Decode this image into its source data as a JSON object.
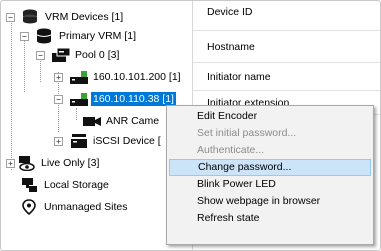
{
  "tree": {
    "vrm_devices": "VRM Devices [1]",
    "primary_vrm": "Primary VRM [1]",
    "pool": "Pool 0 [3]",
    "device_1": "160.10.101.200 [1]",
    "device_2": "160.10.110.38 [1]",
    "anr_camera": "ANR Came",
    "iscsi_device": "iSCSI Device [",
    "live_only": "Live Only [3]",
    "local_storage": "Local Storage",
    "unmanaged_sites": "Unmanaged Sites",
    "expander_collapsed": "+",
    "expander_expanded": "−"
  },
  "properties": {
    "rows": [
      "Device ID",
      "Hostname",
      "Initiator name",
      "Initiator extension"
    ]
  },
  "context_menu": {
    "items": [
      {
        "label": "Edit Encoder",
        "enabled": true
      },
      {
        "label": "Set initial password...",
        "enabled": false
      },
      {
        "label": "Authenticate...",
        "enabled": false
      },
      {
        "label": "Change password...",
        "enabled": true,
        "highlighted": true
      },
      {
        "label": "Blink Power LED",
        "enabled": true
      },
      {
        "label": "Show webpage in browser",
        "enabled": true
      },
      {
        "label": "Refresh state",
        "enabled": true
      }
    ]
  },
  "icons": {
    "vrm_devices": "database-stack-icon",
    "primary_vrm": "database-icon",
    "pool": "storage-pool-icon",
    "device": "encoder-device-icon",
    "camera": "camera-icon",
    "iscsi": "iscsi-icon",
    "live_only": "live-only-icon",
    "local_storage": "local-storage-icon",
    "unmanaged_sites": "location-pin-icon"
  },
  "colors": {
    "selection": "#0078d7",
    "menu_hover": "#cce4f7",
    "device_green": "#3aa335"
  }
}
